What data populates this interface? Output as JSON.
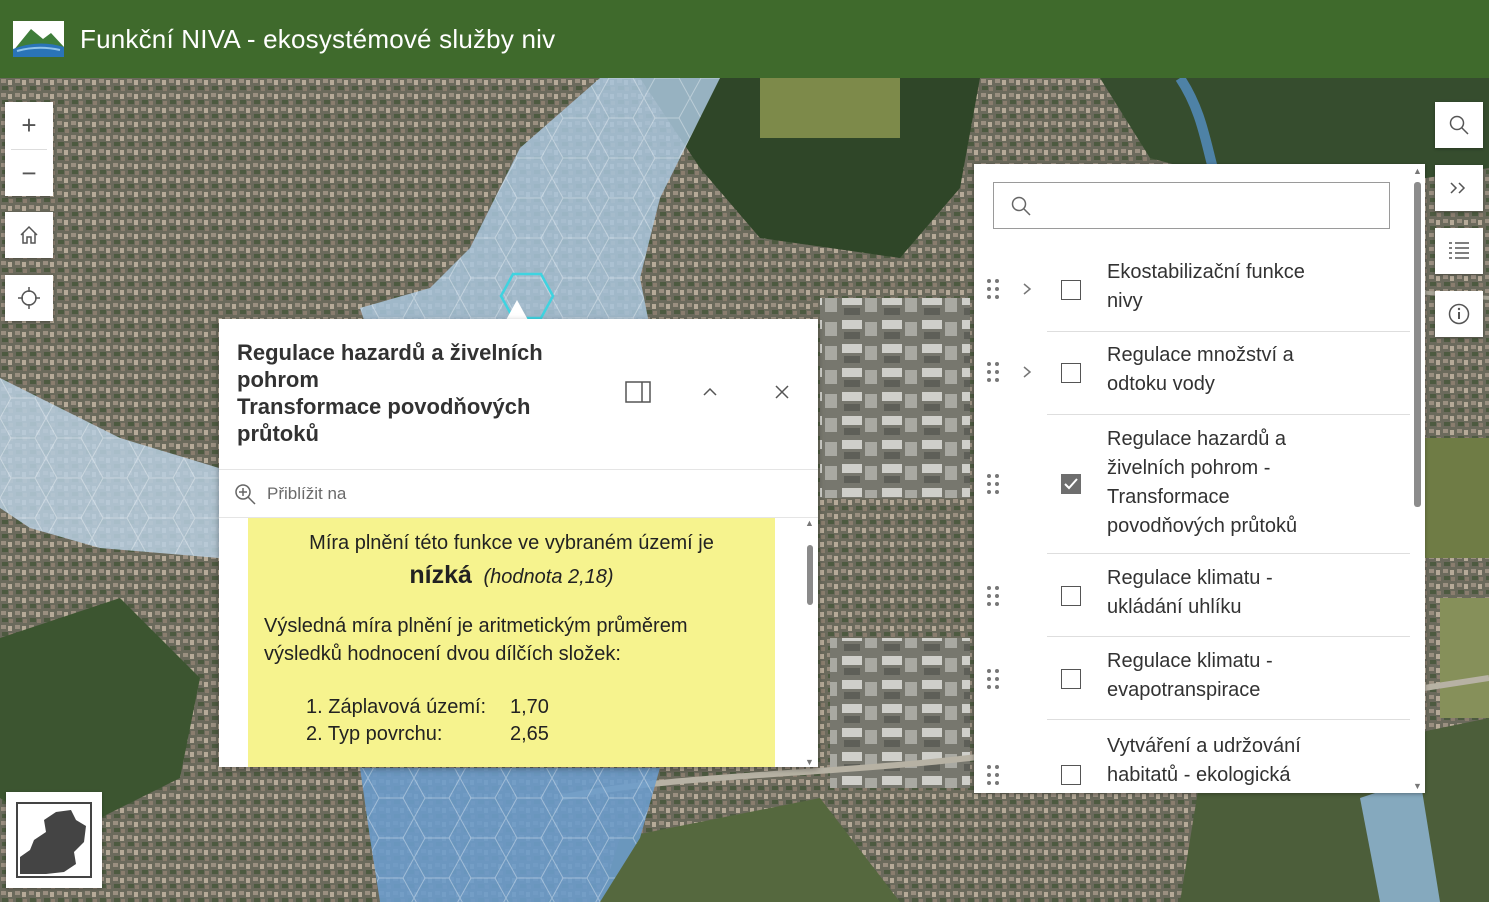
{
  "header": {
    "title": "Funkční NIVA - ekosystémové služby niv",
    "logo_icon": "river-landscape-logo-icon"
  },
  "colors": {
    "header_bg": "#3f6a2c",
    "content_highlight": "#f6f38e",
    "hex_selected": "#3fd3e0"
  },
  "map_tools": {
    "zoom_in": "+",
    "zoom_out": "−",
    "home_icon": "home-icon",
    "locate_icon": "locate-icon",
    "basemap_icon": "basemap-toggle-icon"
  },
  "popup": {
    "title_lines": [
      "Regulace hazardů a živelních",
      "pohrom",
      "Transformace povodňových",
      "průtoků"
    ],
    "actions": [
      "dock-icon",
      "collapse-icon",
      "close-icon"
    ],
    "zoom_to_label": "Přiblížit na",
    "content": {
      "line1": "Míra plnění této funkce ve vybraném území je",
      "level": "nízká",
      "value_text": "(hodnota 2,18)",
      "paragraph": "Výsledná míra plnění je aritmetickým průměrem výsledků hodnocení dvou dílčích složek:",
      "items": [
        {
          "label": "1. Záplavová území:",
          "value": "1,70"
        },
        {
          "label": "2. Typ povrchu:",
          "value": "2,65"
        }
      ]
    }
  },
  "right_tools": [
    "search-icon",
    "collapse-panel-icon",
    "layer-list-icon",
    "info-icon"
  ],
  "layer_panel": {
    "search_placeholder": "",
    "items": [
      {
        "label": "Ekostabilizační funkce nivy",
        "lines": [
          "Ekostabilizační funkce",
          "nivy"
        ],
        "checked": false,
        "expandable": true
      },
      {
        "label": "Regulace množství a odtoku vody",
        "lines": [
          "Regulace množství a",
          "odtoku vody"
        ],
        "checked": false,
        "expandable": true
      },
      {
        "label": "Regulace hazardů a živelních pohrom - Transformace povodňových průtoků",
        "lines": [
          "Regulace hazardů a",
          "živelních pohrom -",
          "Transformace",
          "povodňových průtoků"
        ],
        "checked": true,
        "expandable": false
      },
      {
        "label": "Regulace klimatu - ukládání uhlíku",
        "lines": [
          "Regulace klimatu -",
          "ukládání uhlíku"
        ],
        "checked": false,
        "expandable": false
      },
      {
        "label": "Regulace klimatu - evapotranspirace",
        "lines": [
          "Regulace klimatu -",
          "evapotranspirace"
        ],
        "checked": false,
        "expandable": false
      },
      {
        "label": "Vytváření a udržování habitatů - ekologická",
        "lines": [
          "Vytváření a udržování",
          "habitatů - ekologická"
        ],
        "checked": false,
        "expandable": false
      }
    ]
  }
}
